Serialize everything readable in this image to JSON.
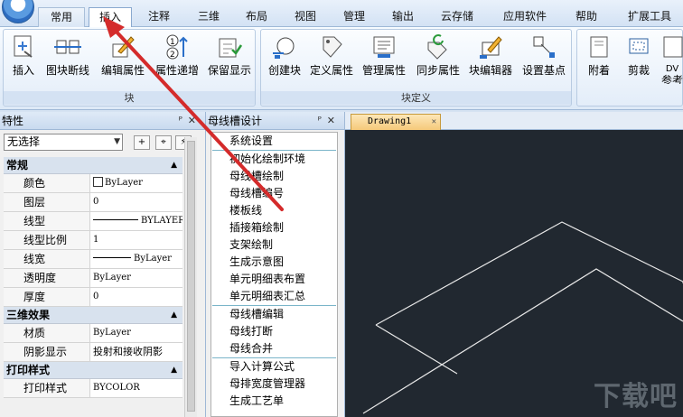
{
  "menu": {
    "tabs": [
      "常用",
      "插入",
      "注释",
      "三维",
      "布局",
      "视图",
      "管理",
      "输出",
      "云存储",
      "应用软件",
      "帮助",
      "扩展工具"
    ],
    "active_tab": "插入"
  },
  "ribbon": {
    "group_block": {
      "label": "块",
      "buttons": [
        "插入",
        "图块断线",
        "编辑属性",
        "属性递增",
        "保留显示"
      ]
    },
    "group_block_def": {
      "label": "块定义",
      "buttons": [
        "创建块",
        "定义属性",
        "管理属性",
        "同步属性",
        "块编辑器",
        "设置基点"
      ]
    },
    "group_third": {
      "buttons": [
        "附着",
        "剪裁",
        "DV",
        "参考"
      ]
    }
  },
  "properties": {
    "title": "特性",
    "selection": "无选择",
    "sections": [
      {
        "title": "常规",
        "rows": [
          {
            "key": "颜色",
            "value": "ByLayer"
          },
          {
            "key": "图层",
            "value": "0"
          },
          {
            "key": "线型",
            "value": "BYLAYER"
          },
          {
            "key": "线型比例",
            "value": "1"
          },
          {
            "key": "线宽",
            "value": "ByLayer"
          },
          {
            "key": "透明度",
            "value": "ByLayer"
          },
          {
            "key": "厚度",
            "value": "0"
          }
        ]
      },
      {
        "title": "三维效果",
        "rows": [
          {
            "key": "材质",
            "value": "ByLayer"
          },
          {
            "key": "阴影显示",
            "value": "投射和接收阴影"
          }
        ]
      },
      {
        "title": "打印样式",
        "rows": [
          {
            "key": "打印样式",
            "value": "BYCOLOR"
          }
        ]
      }
    ]
  },
  "busbar": {
    "title": "母线槽设计",
    "groups": [
      [
        "系统设置"
      ],
      [
        "初始化绘制环境",
        "母线槽绘制",
        "母线槽编号",
        "楼板线",
        "插接箱绘制",
        "支架绘制",
        "生成示意图",
        "单元明细表布置",
        "单元明细表汇总"
      ],
      [
        "母线槽编辑",
        "母线打断",
        "母线合并"
      ],
      [
        "导入计算公式",
        "母排宽度管理器",
        "生成工艺单"
      ]
    ]
  },
  "drawing": {
    "tab_label": "Drawing1",
    "watermark": "下载吧"
  },
  "colors": {
    "annotation_arrow": "#d42b2b",
    "canvas_bg": "#212830",
    "ribbon_bg": "#dde9f7"
  }
}
